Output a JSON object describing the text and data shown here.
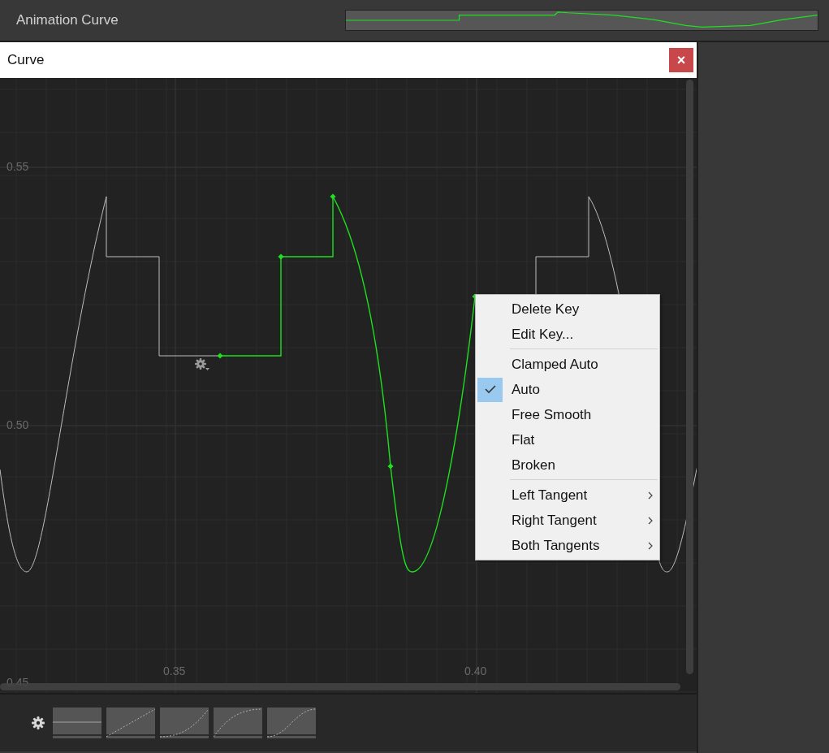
{
  "inspector": {
    "label": "Animation Curve"
  },
  "window": {
    "title": "Curve",
    "close": "×"
  },
  "canvas": {
    "y_labels": [
      "0.55",
      "0.50",
      "0.45"
    ],
    "x_labels": [
      "0.35",
      "0.40"
    ]
  },
  "context_menu": {
    "groups": [
      {
        "items": [
          {
            "label": "Delete Key",
            "kind": "action"
          },
          {
            "label": "Edit Key...",
            "kind": "action"
          }
        ]
      },
      {
        "items": [
          {
            "label": "Clamped Auto",
            "kind": "option",
            "checked": false
          },
          {
            "label": "Auto",
            "kind": "option",
            "checked": true
          },
          {
            "label": "Free Smooth",
            "kind": "option",
            "checked": false
          },
          {
            "label": "Flat",
            "kind": "option",
            "checked": false
          },
          {
            "label": "Broken",
            "kind": "option",
            "checked": false
          }
        ]
      },
      {
        "items": [
          {
            "label": "Left Tangent",
            "kind": "submenu"
          },
          {
            "label": "Right Tangent",
            "kind": "submenu"
          },
          {
            "label": "Both Tangents",
            "kind": "submenu"
          }
        ]
      }
    ]
  },
  "presets": [
    {
      "kind": "flat"
    },
    {
      "kind": "linear"
    },
    {
      "kind": "ease-in"
    },
    {
      "kind": "ease-out"
    },
    {
      "kind": "ease-in-out"
    }
  ]
}
